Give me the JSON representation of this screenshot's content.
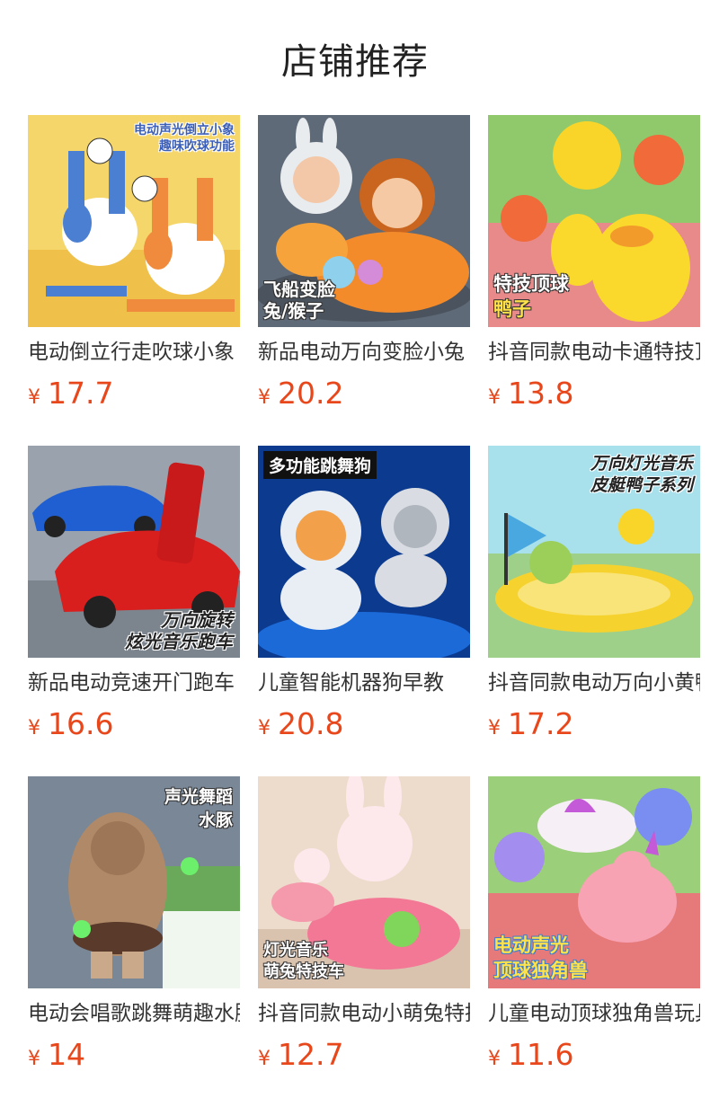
{
  "header": {
    "title": "店铺推荐"
  },
  "products": [
    {
      "name": "电动倒立行走吹球小象",
      "currency": "¥",
      "price": "17.7",
      "overlay": [
        "电动声光倒立小象",
        "趣味吹球功能"
      ]
    },
    {
      "name": "新品电动万向变脸小兔",
      "currency": "¥",
      "price": "20.2",
      "overlay": [
        "飞船变脸",
        "兔/猴子"
      ]
    },
    {
      "name": "抖音同款电动卡通特技顶球鸭子",
      "currency": "¥",
      "price": "13.8",
      "overlay": [
        "特技顶球",
        "鸭子"
      ]
    },
    {
      "name": "新品电动竞速开门跑车",
      "currency": "¥",
      "price": "16.6",
      "overlay": [
        "万向旋转",
        "炫光音乐跑车"
      ]
    },
    {
      "name": "儿童智能机器狗早教",
      "currency": "¥",
      "price": "20.8",
      "overlay": [
        "多功能跳舞狗"
      ]
    },
    {
      "name": "抖音同款电动万向小黄鸭皮艇",
      "currency": "¥",
      "price": "17.2",
      "overlay": [
        "万向灯光音乐",
        "皮艇鸭子系列"
      ]
    },
    {
      "name": "电动会唱歌跳舞萌趣水豚",
      "currency": "¥",
      "price": "14",
      "overlay": [
        "声光舞蹈",
        "水豚"
      ]
    },
    {
      "name": "抖音同款电动小萌兔特技车",
      "currency": "¥",
      "price": "12.7",
      "overlay": [
        "灯光音乐",
        "萌兔特技车"
      ]
    },
    {
      "name": "儿童电动顶球独角兽玩具",
      "currency": "¥",
      "price": "11.6",
      "overlay": [
        "电动声光",
        "顶球独角兽"
      ]
    }
  ]
}
